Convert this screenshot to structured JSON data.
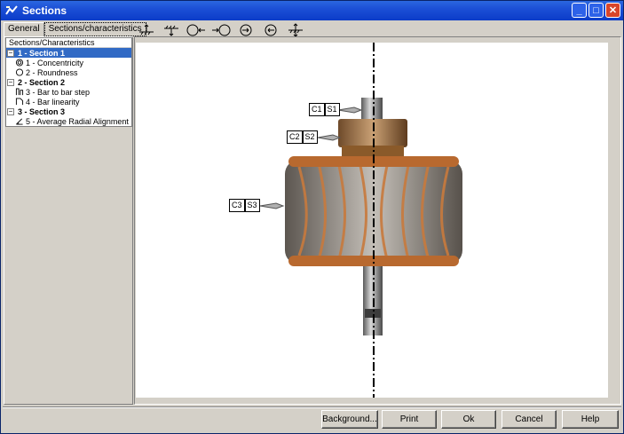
{
  "window": {
    "title": "Sections",
    "minimize": "_",
    "maximize": "□",
    "close": "✕"
  },
  "tabs": [
    {
      "label": "General"
    },
    {
      "label": "Sections/characteristics"
    }
  ],
  "tree": {
    "header": "Sections/Characteristics",
    "sections": [
      {
        "toggle": "−",
        "label": "1 - Section 1",
        "items": [
          {
            "icon": "concentricity-icon",
            "label": "1 - Concentricity"
          },
          {
            "icon": "roundness-icon",
            "label": "2 - Roundness"
          }
        ]
      },
      {
        "toggle": "−",
        "label": "2 - Section 2",
        "items": [
          {
            "icon": "bar-step-icon",
            "label": "3 - Bar to bar step"
          },
          {
            "icon": "bar-linearity-icon",
            "label": "4 - Bar linearity"
          }
        ]
      },
      {
        "toggle": "−",
        "label": "3 - Section 3",
        "items": [
          {
            "icon": "radial-alignment-icon",
            "label": "5 - Average Radial Alignment"
          }
        ]
      }
    ]
  },
  "toolbar": [
    "datum-up-icon",
    "datum-down-icon",
    "circle-left-icon",
    "circle-right-icon",
    "circle-arrow-in-icon",
    "circle-arrow-out-icon",
    "datum-both-icon"
  ],
  "probes": [
    {
      "c": "C1",
      "s": "S1"
    },
    {
      "c": "C2",
      "s": "S2"
    },
    {
      "c": "C3",
      "s": "S3"
    }
  ],
  "buttons": {
    "background": "Background...",
    "print": "Print",
    "ok": "Ok",
    "cancel": "Cancel",
    "help": "Help"
  },
  "colors": {
    "selection": "#316ac5",
    "titlebar": "#0b3cc8",
    "copper": "#c87a3d"
  }
}
